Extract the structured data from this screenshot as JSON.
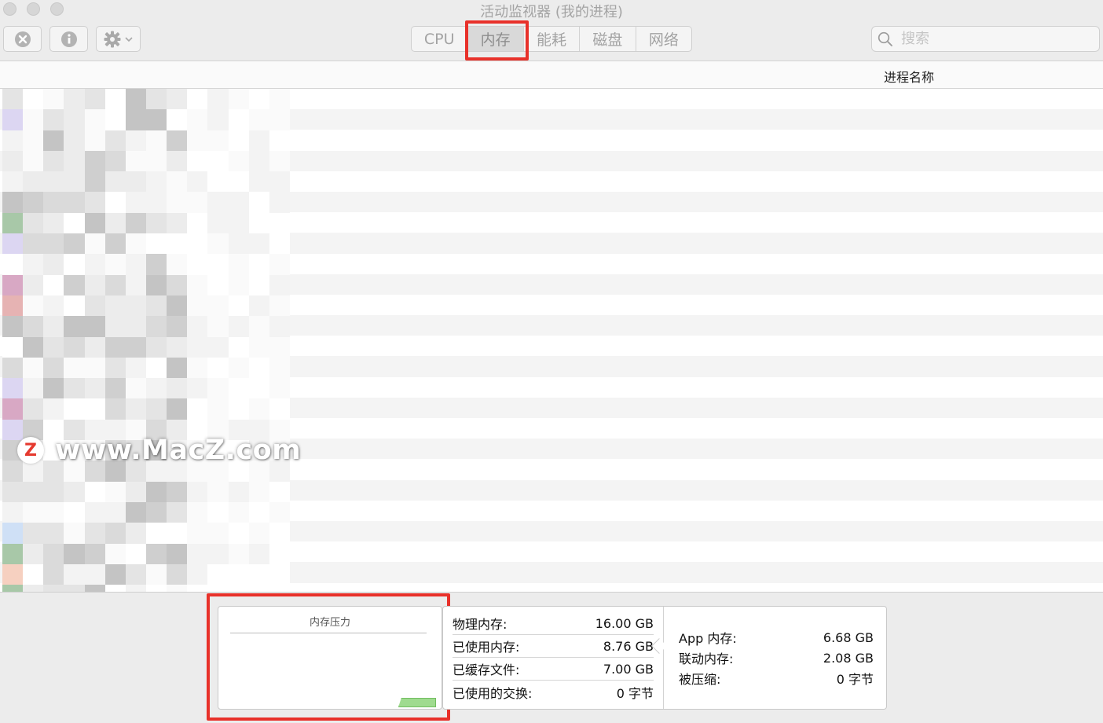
{
  "window": {
    "title": "活动监视器 (我的进程)"
  },
  "toolbar": {
    "stop_icon": "close-circle-icon",
    "info_icon": "info-circle-icon",
    "gear_icon": "gear-icon"
  },
  "tabs": [
    {
      "label": "CPU",
      "active": false
    },
    {
      "label": "内存",
      "active": true
    },
    {
      "label": "能耗",
      "active": false
    },
    {
      "label": "磁盘",
      "active": false
    },
    {
      "label": "网络",
      "active": false
    }
  ],
  "search": {
    "placeholder": "搜索"
  },
  "table": {
    "column_header": "进程名称"
  },
  "watermark": {
    "logo": "Z",
    "text": "www.MacZ.com"
  },
  "memory_pressure": {
    "title": "内存压力"
  },
  "stats_left": [
    {
      "label": "物理内存:",
      "value": "16.00 GB"
    },
    {
      "label": "已使用内存:",
      "value": "8.76 GB"
    },
    {
      "label": "已缓存文件:",
      "value": "7.00 GB"
    },
    {
      "label": "已使用的交换:",
      "value": "0 字节"
    }
  ],
  "stats_right": [
    {
      "label": "App 内存:",
      "value": "6.68 GB"
    },
    {
      "label": "联动内存:",
      "value": "2.08 GB"
    },
    {
      "label": "被压缩:",
      "value": "0 字节"
    }
  ],
  "colors": {
    "highlight": "#e8312a",
    "pressure_green": "#9fdb8f"
  }
}
